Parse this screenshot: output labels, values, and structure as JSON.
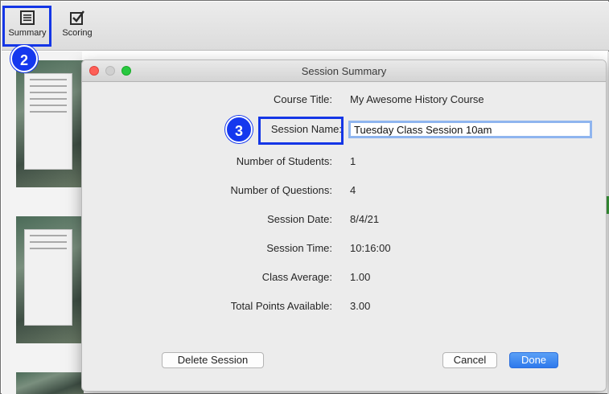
{
  "toolbar": {
    "summary_label": "Summary",
    "scoring_label": "Scoring"
  },
  "callouts": {
    "step2": "2",
    "step3": "3",
    "color": "#1538ee"
  },
  "dialog": {
    "title": "Session Summary",
    "fields": {
      "course_title_label": "Course Title:",
      "course_title_value": "My Awesome History Course",
      "session_name_label": "Session Name:",
      "session_name_value": "Tuesday Class Session 10am",
      "students_label": "Number of Students:",
      "students_value": "1",
      "questions_label": "Number of Questions:",
      "questions_value": "4",
      "date_label": "Session Date:",
      "date_value": "8/4/21",
      "time_label": "Session Time:",
      "time_value": "10:16:00",
      "average_label": "Class Average:",
      "average_value": "1.00",
      "points_label": "Total Points Available:",
      "points_value": "3.00"
    },
    "buttons": {
      "delete": "Delete Session",
      "cancel": "Cancel",
      "done": "Done"
    },
    "colors": {
      "done_button": "#2e79ec",
      "close_light": "#fe5f57",
      "zoom_light": "#28c840"
    }
  }
}
